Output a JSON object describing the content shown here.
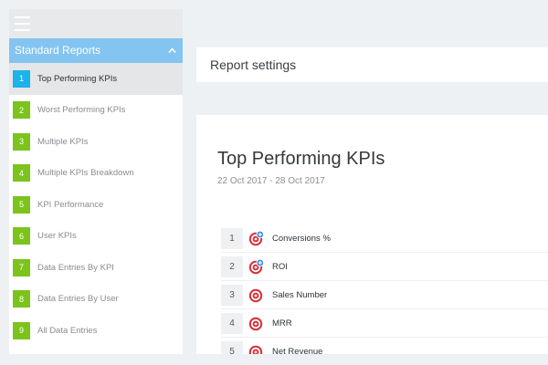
{
  "sidebar": {
    "section_title": "Standard Reports",
    "items": [
      {
        "num": "1",
        "label": "Top Performing KPIs",
        "active": true
      },
      {
        "num": "2",
        "label": "Worst Performing KPIs",
        "active": false
      },
      {
        "num": "3",
        "label": "Multiple KPIs",
        "active": false
      },
      {
        "num": "4",
        "label": "Multiple KPIs Breakdown",
        "active": false
      },
      {
        "num": "5",
        "label": "KPI Performance",
        "active": false
      },
      {
        "num": "6",
        "label": "User KPIs",
        "active": false
      },
      {
        "num": "7",
        "label": "Data Entries By KPI",
        "active": false
      },
      {
        "num": "8",
        "label": "Data Entries By User",
        "active": false
      },
      {
        "num": "9",
        "label": "All Data Entries",
        "active": false
      }
    ]
  },
  "settings": {
    "title": "Report settings"
  },
  "report": {
    "title": "Top Performing KPIs",
    "dates": "22 Oct 2017 - 28 Oct 2017",
    "kpis": [
      {
        "rank": "1",
        "name": "Conversions %",
        "icon": "target-plus-icon"
      },
      {
        "rank": "2",
        "name": "ROI",
        "icon": "target-plus-icon"
      },
      {
        "rank": "3",
        "name": "Sales Number",
        "icon": "target-icon"
      },
      {
        "rank": "4",
        "name": "MRR",
        "icon": "target-icon"
      },
      {
        "rank": "5",
        "name": "Net Revenue",
        "icon": "target-icon"
      }
    ]
  },
  "colors": {
    "accent_header": "#83c4f0",
    "active_badge": "#1cb2ea",
    "badge": "#7cc31c",
    "target_red": "#d9303a",
    "plus_blue": "#3a8fde"
  }
}
